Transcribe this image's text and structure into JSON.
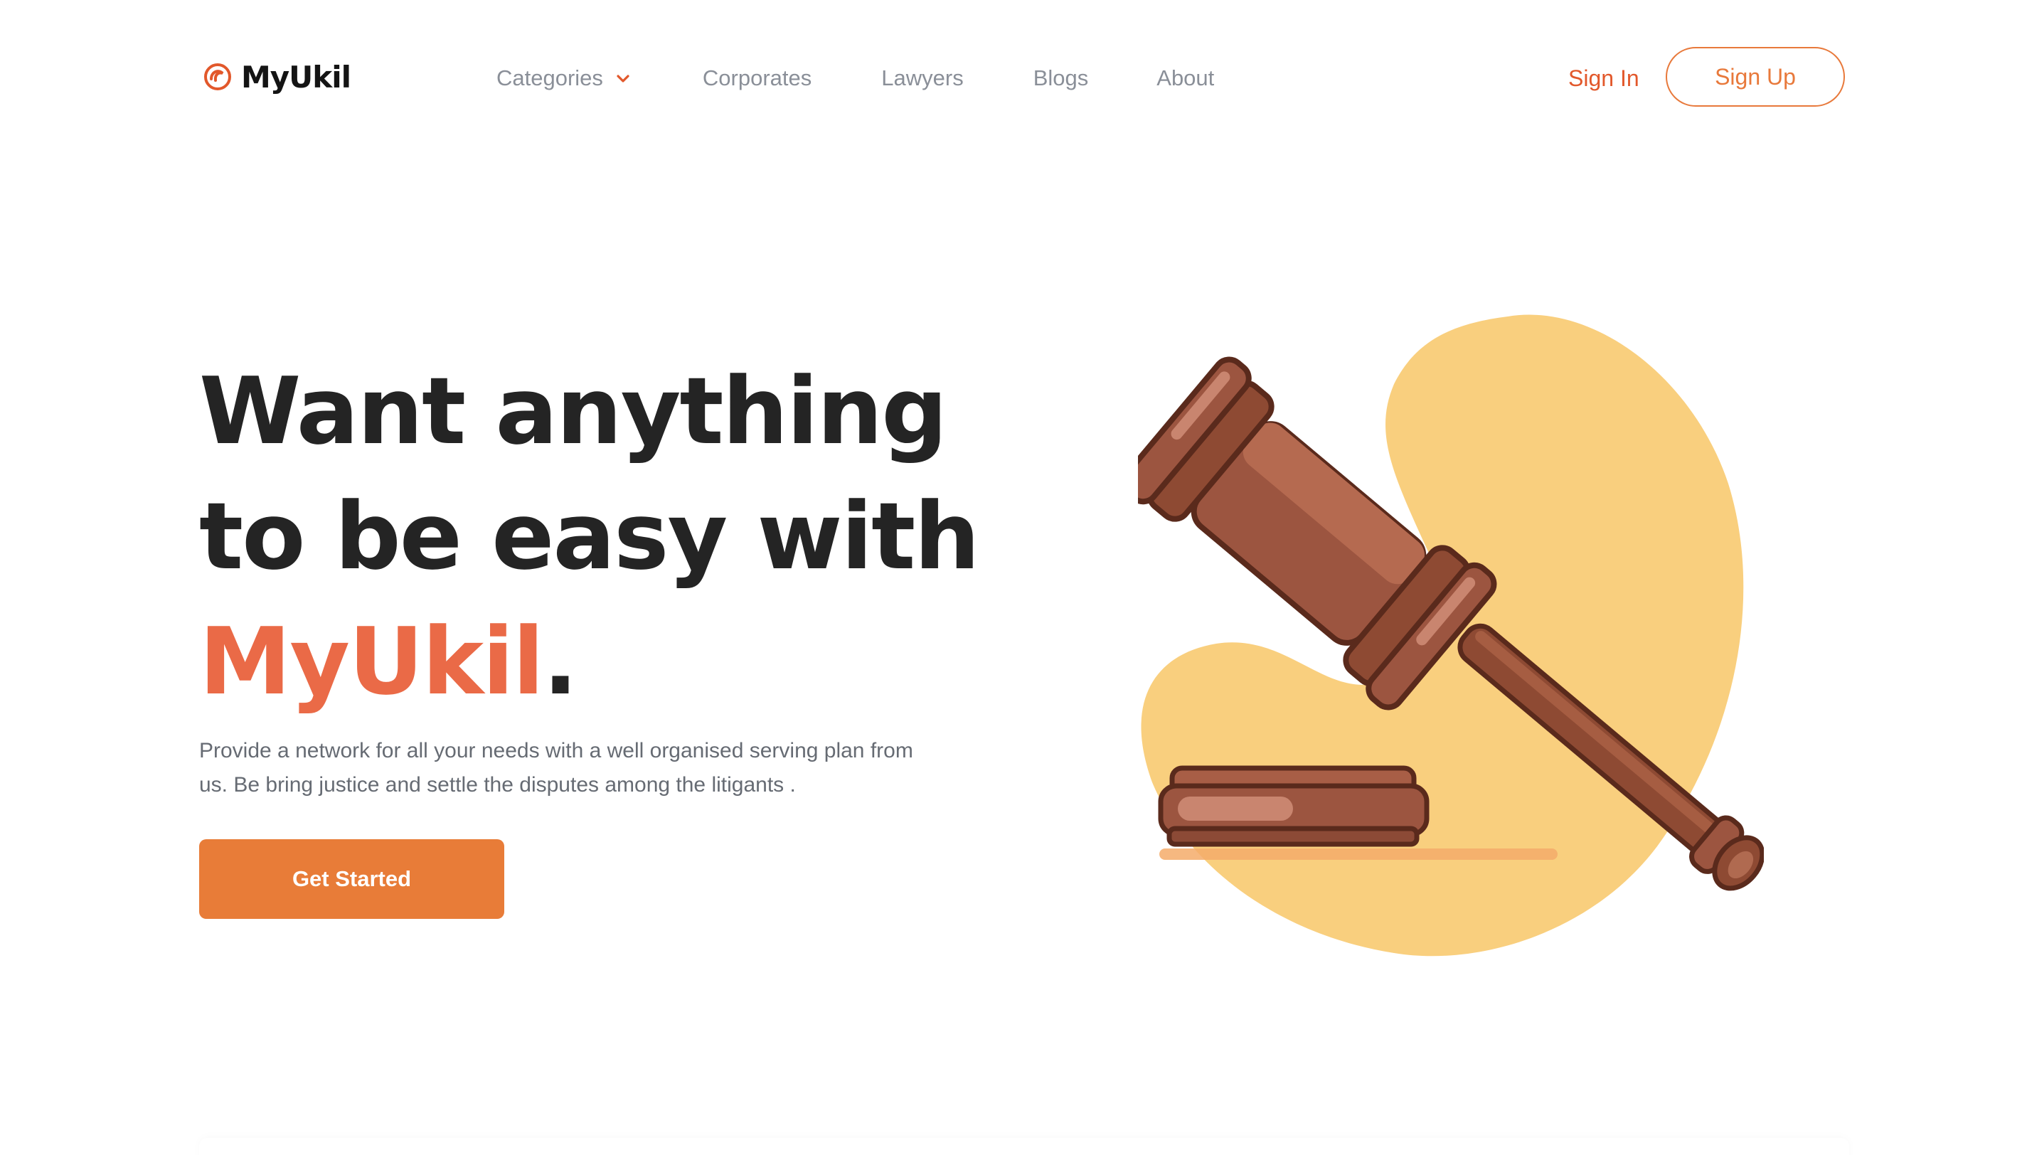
{
  "brand": {
    "name": "MyUkil",
    "logo_icon": "logo-swirl-icon",
    "accent": "#ea6a47",
    "cta_color": "#e87c38"
  },
  "nav": {
    "links": [
      {
        "label": "Categories",
        "has_dropdown": true,
        "icon": "chevron-down-icon"
      },
      {
        "label": "Corporates"
      },
      {
        "label": "Lawyers"
      },
      {
        "label": "Blogs"
      },
      {
        "label": "About"
      }
    ],
    "sign_in": "Sign In",
    "sign_up": "Sign Up"
  },
  "hero": {
    "title_line1": "Want anything",
    "title_line2": "to be easy with",
    "title_brand": "MyUkil",
    "title_end": ".",
    "subtitle_line1": "Provide a network for all your needs with a well organised serving plan from",
    "subtitle_line2": "us. Be bring justice and settle the disputes among the litigants .",
    "cta_label": "Get Started"
  },
  "illustration": {
    "icon": "gavel-icon",
    "blob_color": "#f9cf7e"
  }
}
